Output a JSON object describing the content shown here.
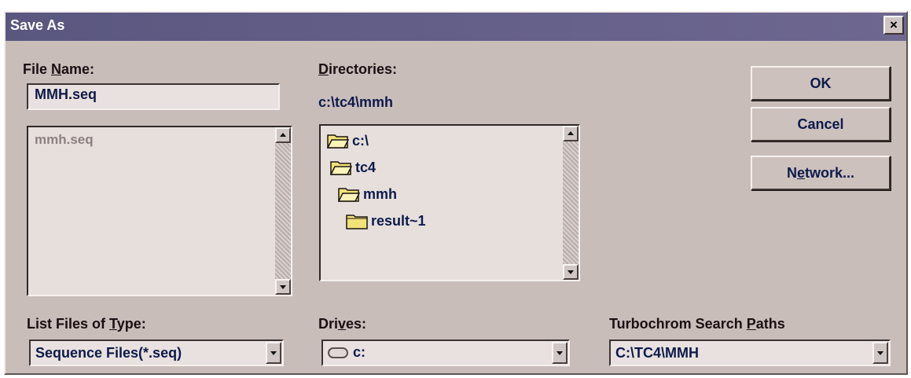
{
  "dialog": {
    "title": "Save As",
    "close_label": "×"
  },
  "file_name": {
    "label_pre": "File ",
    "label_key": "N",
    "label_post": "ame:",
    "value": "MMH.seq",
    "files": [
      "mmh.seq"
    ]
  },
  "directories": {
    "label_key": "D",
    "label_post": "irectories:",
    "current_path": "c:\\tc4\\mmh",
    "tree": [
      {
        "name": "c:\\",
        "icon": "open-folder-icon"
      },
      {
        "name": "tc4",
        "icon": "open-folder-icon"
      },
      {
        "name": "mmh",
        "icon": "open-folder-icon"
      },
      {
        "name": "result~1",
        "icon": "folder-icon"
      }
    ]
  },
  "buttons": {
    "ok": "OK",
    "cancel": "Cancel",
    "network_pre": "N",
    "network_key": "e",
    "network_post": "twork..."
  },
  "list_type": {
    "label_pre": "List Files of ",
    "label_key": "T",
    "label_post": "ype:",
    "value": "Sequence Files(*.seq)"
  },
  "drives": {
    "label_pre": "Dri",
    "label_key": "v",
    "label_post": "es:",
    "value": "c:",
    "icon": "drive-icon"
  },
  "search_paths": {
    "label_pre": "Turbochrom Search ",
    "label_key": "P",
    "label_post": "aths",
    "value": "C:\\TC4\\MMH"
  },
  "colors": {
    "dialog_face": "#c9bdba",
    "titlebar": "#5a577f",
    "text_navy": "#0d1a4a",
    "folder_yellow": "#f2e27a"
  }
}
